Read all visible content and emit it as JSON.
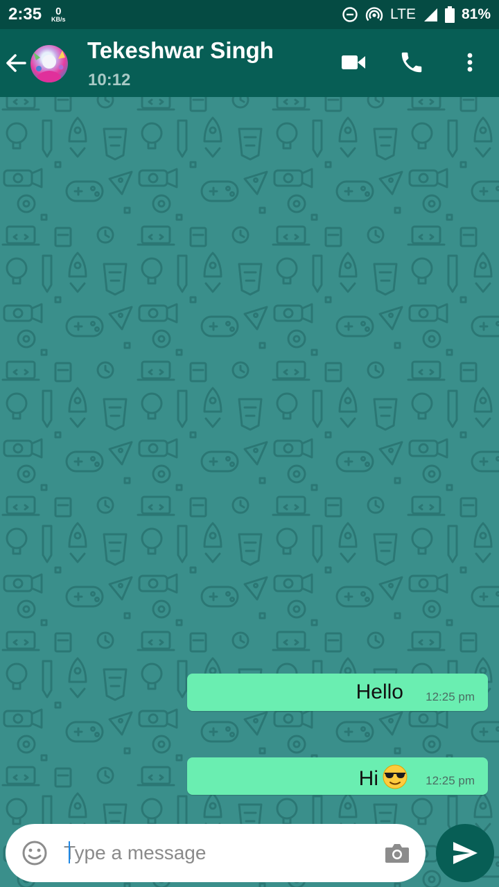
{
  "status_bar": {
    "time": "2:35",
    "net_speed_value": "0",
    "net_speed_unit": "KB/s",
    "network_type": "LTE",
    "battery": "81%",
    "icons": [
      "do-not-disturb-icon",
      "hotspot-icon",
      "signal-icon",
      "battery-icon"
    ]
  },
  "header": {
    "contact_name": "Tekeshwar Singh",
    "contact_status": "10:12",
    "icons": [
      "back-arrow-icon",
      "video-call-icon",
      "phone-icon",
      "more-vert-icon"
    ]
  },
  "messages": [
    {
      "text": "Hello",
      "time": "12:25 pm",
      "direction": "outgoing"
    },
    {
      "text": "Hi",
      "emoji": "smiling-face-with-sunglasses",
      "time": "12:25 pm",
      "direction": "outgoing"
    }
  ],
  "composer": {
    "placeholder": "Type a message",
    "value": "",
    "icons": [
      "emoji-icon",
      "camera-icon",
      "send-icon"
    ]
  },
  "colors": {
    "status_bar": "#054b43",
    "app_bar": "#075e55",
    "wallpaper": "#3a8f8b",
    "bubble": "#6aeeb1"
  }
}
